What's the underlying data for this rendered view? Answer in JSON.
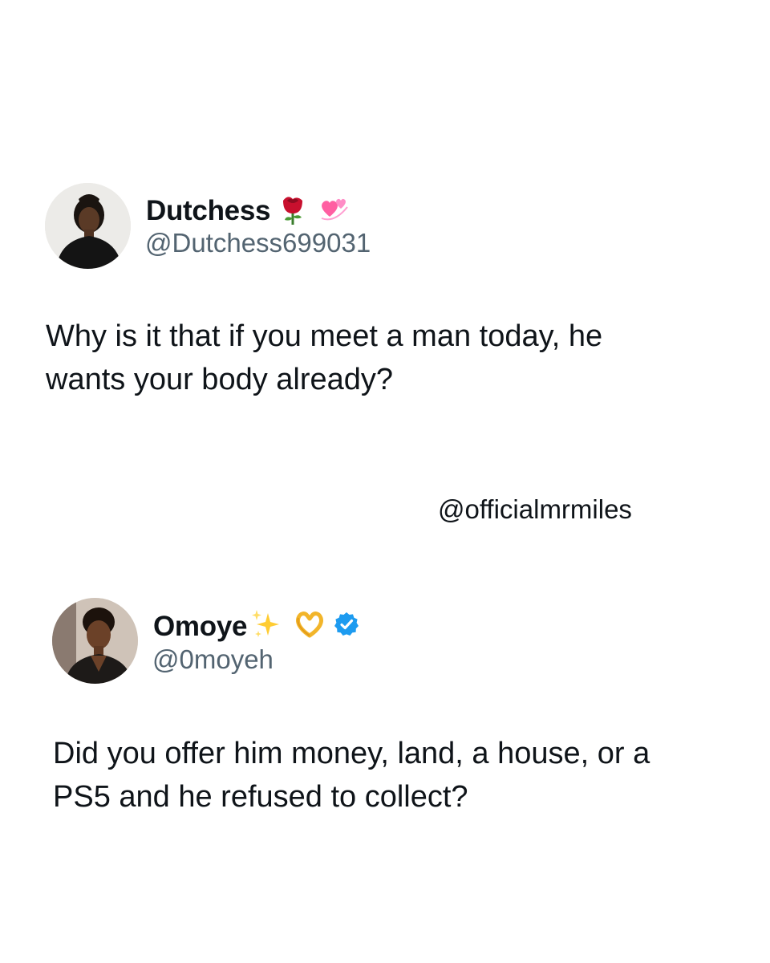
{
  "tweets": [
    {
      "display_name": "Dutchess",
      "handle": "@Dutchess699031",
      "name_emojis": [
        "rose-icon",
        "revolving-hearts-icon"
      ],
      "verified": false,
      "text_lines": [
        "Why is it that if you meet a man today, he",
        "wants your body already?"
      ]
    },
    {
      "display_name": "Omoye",
      "handle": "@0moyeh",
      "name_emojis": [
        "sparkles-icon",
        "heart-hands-icon"
      ],
      "verified": true,
      "text_lines": [
        "Did you offer him money, land, a house, or a",
        "PS5 and he refused to collect?"
      ]
    }
  ],
  "watermark": "@officialmrmiles",
  "colors": {
    "text": "#0f1419",
    "handle": "#536471",
    "verified": "#1d9bf0",
    "background": "#ffffff"
  }
}
